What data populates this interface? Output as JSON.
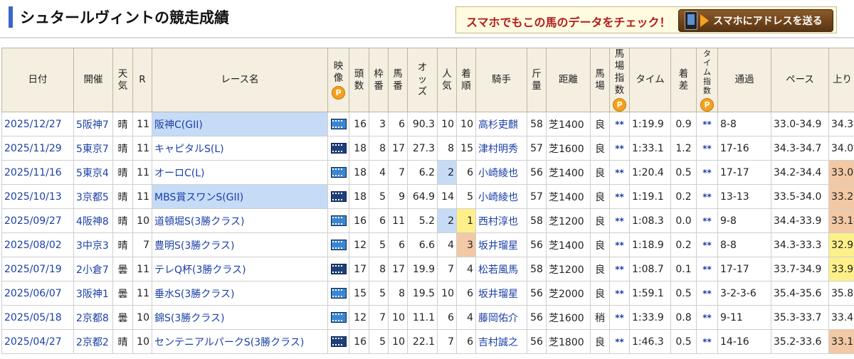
{
  "header": {
    "title": "シュタールヴィントの競走成績",
    "promo_text": "スマホでもこの馬のデータをチェック！",
    "promo_button": "スマホにアドレスを送る"
  },
  "table": {
    "headers": {
      "date": "日付",
      "venue": "開催",
      "weather": "天気",
      "r": "R",
      "race_name": "レース名",
      "video": "映像",
      "runners": "頭数",
      "frame": "枠番",
      "horse_no": "馬番",
      "odds": "オッズ",
      "pop": "人気",
      "finish": "着順",
      "jockey": "騎手",
      "weight": "斤量",
      "distance": "距離",
      "track": "馬場",
      "track_index": "馬場指数",
      "time": "タイム",
      "margin": "着差",
      "time_index": "タイム指数",
      "passing": "通過",
      "pace": "ペース",
      "last3f": "上り",
      "p_badge": "P"
    },
    "rows": [
      {
        "date": "2025/12/27",
        "venue": "5阪神7",
        "weather": "晴",
        "r": "11",
        "race": "阪神C(GII)",
        "race_hl": true,
        "video_light": true,
        "runners": "16",
        "frame": "3",
        "num": "6",
        "odds": "90.3",
        "pop": "10",
        "pop_hl": false,
        "finish": "10",
        "finish_hl": "",
        "jockey": "高杉吏麒",
        "weight": "58",
        "distance": "芝1400",
        "track": "良",
        "track_index": "**",
        "time": "1:19.9",
        "margin": "0.9",
        "time_index": "**",
        "passing": "8-8",
        "pace": "33.0-34.9",
        "last3f": "34.3",
        "up_hl": ""
      },
      {
        "date": "2025/11/29",
        "venue": "5東京7",
        "weather": "晴",
        "r": "11",
        "race": "キャピタルS(L)",
        "race_hl": false,
        "video_light": false,
        "runners": "18",
        "frame": "8",
        "num": "17",
        "odds": "27.3",
        "pop": "8",
        "pop_hl": false,
        "finish": "15",
        "finish_hl": "",
        "jockey": "津村明秀",
        "weight": "57",
        "distance": "芝1600",
        "track": "良",
        "track_index": "**",
        "time": "1:33.1",
        "margin": "1.2",
        "time_index": "**",
        "passing": "17-16",
        "pace": "34.3-34.7",
        "last3f": "34.0",
        "up_hl": ""
      },
      {
        "date": "2025/11/16",
        "venue": "5東京4",
        "weather": "晴",
        "r": "11",
        "race": "オーロC(L)",
        "race_hl": false,
        "video_light": true,
        "runners": "18",
        "frame": "4",
        "num": "7",
        "odds": "6.2",
        "pop": "2",
        "pop_hl": true,
        "finish": "6",
        "finish_hl": "",
        "jockey": "小崎綾也",
        "weight": "56",
        "distance": "芝1400",
        "track": "良",
        "track_index": "**",
        "time": "1:20.4",
        "margin": "0.5",
        "time_index": "**",
        "passing": "17-17",
        "pace": "34.2-34.4",
        "last3f": "33.0",
        "up_hl": "up-3"
      },
      {
        "date": "2025/10/13",
        "venue": "3京都5",
        "weather": "晴",
        "r": "11",
        "race": "MBS賞スワンS(GII)",
        "race_hl": true,
        "video_light": false,
        "runners": "18",
        "frame": "5",
        "num": "9",
        "odds": "64.9",
        "pop": "14",
        "pop_hl": false,
        "finish": "5",
        "finish_hl": "",
        "jockey": "小崎綾也",
        "weight": "57",
        "distance": "芝1400",
        "track": "良",
        "track_index": "**",
        "time": "1:19.1",
        "margin": "0.2",
        "time_index": "**",
        "passing": "13-13",
        "pace": "33.5-34.0",
        "last3f": "33.2",
        "up_hl": "up-3"
      },
      {
        "date": "2025/09/27",
        "venue": "4阪神8",
        "weather": "晴",
        "r": "10",
        "race": "道頓堀S(3勝クラス)",
        "race_hl": false,
        "video_light": true,
        "runners": "16",
        "frame": "6",
        "num": "11",
        "odds": "5.2",
        "pop": "2",
        "pop_hl": true,
        "finish": "1",
        "finish_hl": "fin-1",
        "jockey": "西村淳也",
        "weight": "58",
        "distance": "芝1200",
        "track": "良",
        "track_index": "**",
        "time": "1:08.3",
        "margin": "0.0",
        "time_index": "**",
        "passing": "9-8",
        "pace": "34.4-33.9",
        "last3f": "33.1",
        "up_hl": "up-3"
      },
      {
        "date": "2025/08/02",
        "venue": "3中京3",
        "weather": "晴",
        "r": "7",
        "race": "豊明S(3勝クラス)",
        "race_hl": false,
        "video_light": true,
        "runners": "12",
        "frame": "5",
        "num": "6",
        "odds": "6.6",
        "pop": "4",
        "pop_hl": false,
        "finish": "3",
        "finish_hl": "fin-3",
        "jockey": "坂井瑠星",
        "weight": "56",
        "distance": "芝1400",
        "track": "良",
        "track_index": "**",
        "time": "1:18.9",
        "margin": "0.2",
        "time_index": "**",
        "passing": "8-8",
        "pace": "34.3-33.3",
        "last3f": "32.9",
        "up_hl": "up-1"
      },
      {
        "date": "2025/07/19",
        "venue": "2小倉7",
        "weather": "曇",
        "r": "11",
        "race": "テレQ杯(3勝クラス)",
        "race_hl": false,
        "video_light": false,
        "runners": "17",
        "frame": "8",
        "num": "17",
        "odds": "19.9",
        "pop": "7",
        "pop_hl": false,
        "finish": "4",
        "finish_hl": "",
        "jockey": "松若風馬",
        "weight": "58",
        "distance": "芝1200",
        "track": "良",
        "track_index": "**",
        "time": "1:08.7",
        "margin": "0.1",
        "time_index": "**",
        "passing": "17-17",
        "pace": "33.7-34.9",
        "last3f": "33.9",
        "up_hl": "up-1"
      },
      {
        "date": "2025/06/07",
        "venue": "3阪神1",
        "weather": "曇",
        "r": "11",
        "race": "垂水S(3勝クラス)",
        "race_hl": false,
        "video_light": true,
        "runners": "15",
        "frame": "5",
        "num": "8",
        "odds": "19.5",
        "pop": "10",
        "pop_hl": false,
        "finish": "6",
        "finish_hl": "",
        "jockey": "坂井瑠星",
        "weight": "56",
        "distance": "芝2000",
        "track": "良",
        "track_index": "**",
        "time": "1:59.1",
        "margin": "0.5",
        "time_index": "**",
        "passing": "3-2-3-6",
        "pace": "35.4-35.6",
        "last3f": "35.8",
        "up_hl": ""
      },
      {
        "date": "2025/05/18",
        "venue": "2京都8",
        "weather": "曇",
        "r": "10",
        "race": "錦S(3勝クラス)",
        "race_hl": false,
        "video_light": true,
        "runners": "12",
        "frame": "7",
        "num": "10",
        "odds": "11.1",
        "pop": "6",
        "pop_hl": false,
        "finish": "4",
        "finish_hl": "",
        "jockey": "藤岡佑介",
        "weight": "56",
        "distance": "芝1600",
        "track": "稍",
        "track_index": "**",
        "time": "1:33.9",
        "margin": "0.8",
        "time_index": "**",
        "passing": "9-11",
        "pace": "35.3-33.7",
        "last3f": "33.4",
        "up_hl": ""
      },
      {
        "date": "2025/04/27",
        "venue": "2京都2",
        "weather": "晴",
        "r": "10",
        "race": "センテニアルパークS(3勝クラス)",
        "race_hl": false,
        "video_light": false,
        "runners": "16",
        "frame": "5",
        "num": "10",
        "odds": "22.1",
        "pop": "7",
        "pop_hl": false,
        "finish": "6",
        "finish_hl": "",
        "jockey": "吉村誠之",
        "weight": "56",
        "distance": "芝1800",
        "track": "良",
        "track_index": "**",
        "time": "1:46.3",
        "margin": "0.5",
        "time_index": "**",
        "passing": "14-16",
        "pace": "35.2-33.6",
        "last3f": "33.1",
        "up_hl": "up-3"
      }
    ]
  }
}
